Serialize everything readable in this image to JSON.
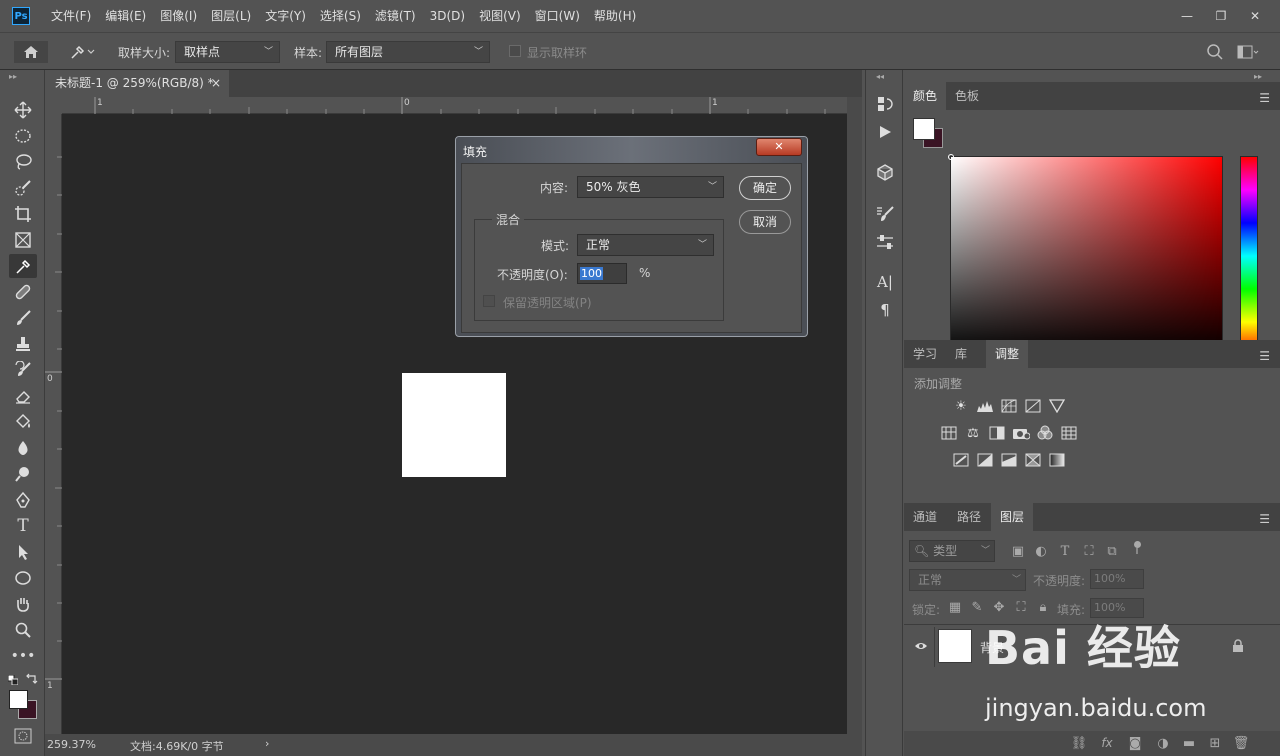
{
  "menu": {
    "logo": "Ps",
    "items": [
      "文件(F)",
      "编辑(E)",
      "图像(I)",
      "图层(L)",
      "文字(Y)",
      "选择(S)",
      "滤镜(T)",
      "3D(D)",
      "视图(V)",
      "窗口(W)",
      "帮助(H)"
    ]
  },
  "window_controls": {
    "minimize": "—",
    "restore": "❐",
    "close": "✕"
  },
  "options": {
    "sample_size_label": "取样大小:",
    "sample_size_value": "取样点",
    "sample_label": "样本:",
    "sample_value": "所有图层",
    "show_ring_label": "显示取样环"
  },
  "document": {
    "tab_title": "未标题-1 @ 259%(RGB/8) *",
    "tab_close": "×",
    "ruler_top": [
      "1",
      "0",
      "1"
    ],
    "ruler_left": [
      "0",
      "1"
    ],
    "zoom": "259.37%",
    "doc_info": "文档:4.69K/0 字节",
    "status_arrow": "›"
  },
  "panels": {
    "color_tabs": [
      "颜色",
      "色板"
    ],
    "adjust_tabs": [
      "学习",
      "库",
      "调整"
    ],
    "add_adjustment": "添加调整",
    "layer_tabs": [
      "通道",
      "路径",
      "图层"
    ],
    "layer_filter": "类型",
    "blend_mode": "正常",
    "opacity_label": "不透明度:",
    "opacity_value": "100%",
    "lock_label": "锁定:",
    "fill_label": "填充:",
    "fill_value": "100%",
    "layer_name": "背景"
  },
  "dialog": {
    "title": "填充",
    "close": "✕",
    "content_label": "内容:",
    "content_value": "50% 灰色",
    "ok": "确定",
    "cancel": "取消",
    "blend_group": "混合",
    "mode_label": "模式:",
    "mode_value": "正常",
    "opacity_label": "不透明度(O):",
    "opacity_value": "100",
    "percent": "%",
    "preserve_label": "保留透明区域(P)"
  },
  "watermark": {
    "brand": "Bai 经验",
    "url": "jingyan.baidu.com"
  },
  "colors": {
    "foreground": "#ffffff",
    "background": "#3a1424",
    "accent": "#31a8ff"
  }
}
